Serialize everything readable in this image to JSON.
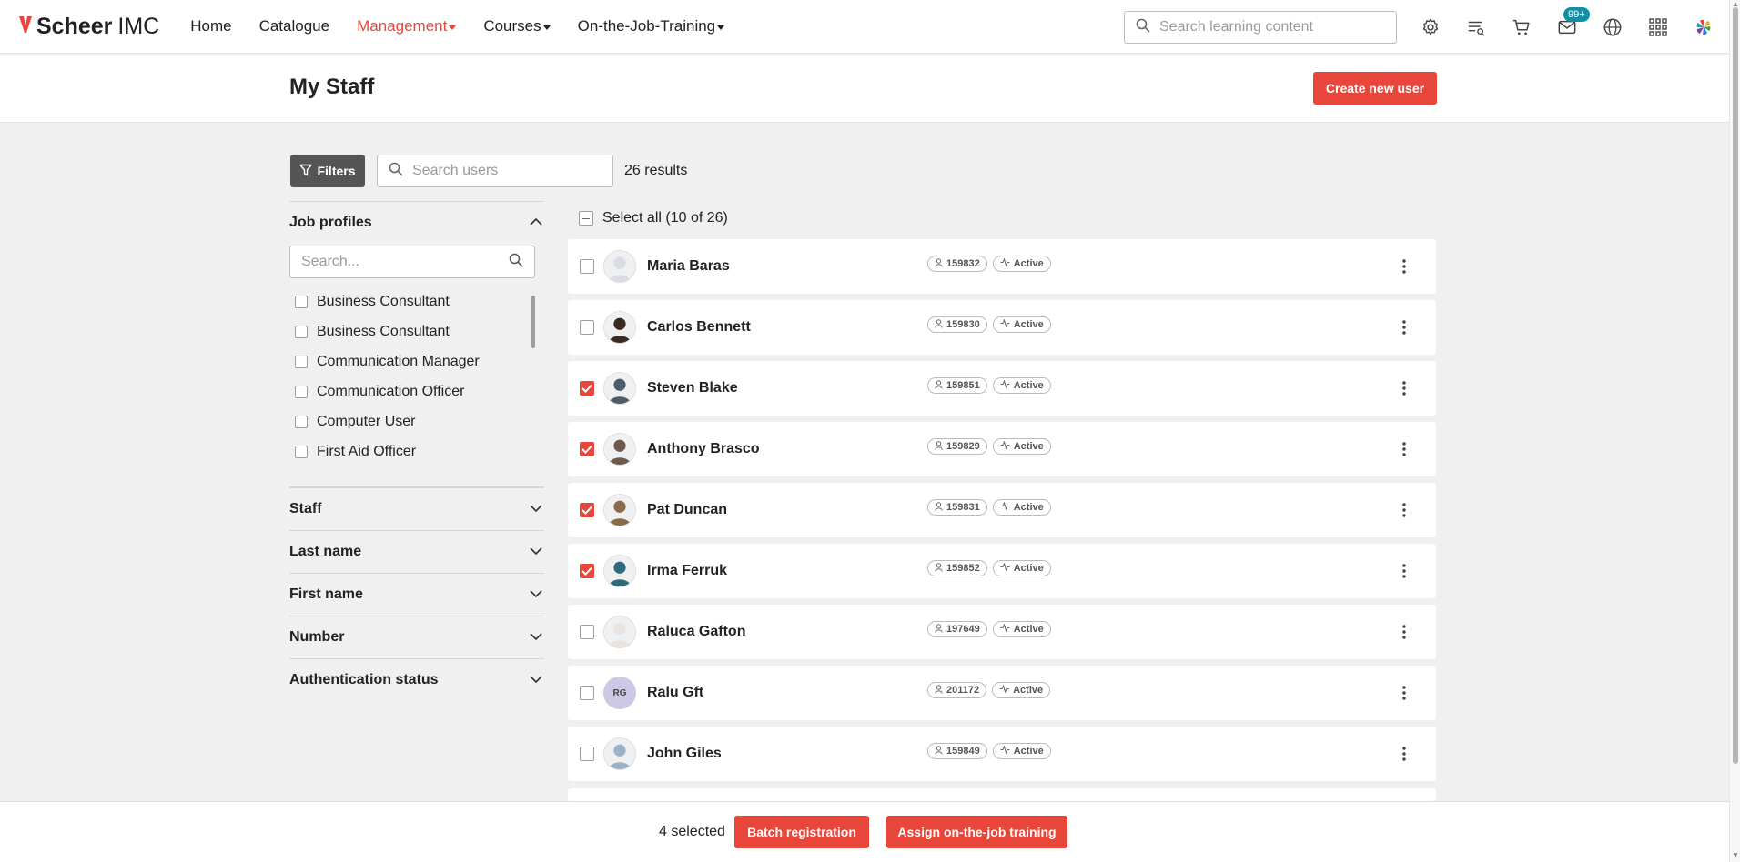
{
  "brand": {
    "name_bold": "Scheer",
    "name_rest": "IMC"
  },
  "nav": {
    "items": [
      "Home",
      "Catalogue",
      "Management",
      "Courses",
      "On-the-Job-Training"
    ],
    "active_item": "Management"
  },
  "global_search": {
    "placeholder": "Search learning content"
  },
  "notifications": {
    "badge": "99+"
  },
  "page": {
    "title": "My Staff",
    "create_button": "Create new user"
  },
  "toolbar": {
    "filters_label": "Filters",
    "search_placeholder": "Search users",
    "results": "26 results"
  },
  "sidebar": {
    "job_profiles": {
      "title": "Job profiles",
      "search_placeholder": "Search...",
      "items": [
        "Business Consultant",
        "Business Consultant",
        "Communication Manager",
        "Communication Officer",
        "Computer User",
        "First Aid Officer"
      ]
    },
    "facets": [
      "Staff",
      "Last name",
      "First name",
      "Number",
      "Authentication status"
    ]
  },
  "list": {
    "select_all": "Select all (10 of 26)",
    "users": [
      {
        "name": "Maria Baras",
        "id": "159832",
        "status": "Active",
        "selected": false
      },
      {
        "name": "Carlos Bennett",
        "id": "159830",
        "status": "Active",
        "selected": false
      },
      {
        "name": "Steven Blake",
        "id": "159851",
        "status": "Active",
        "selected": true
      },
      {
        "name": "Anthony Brasco",
        "id": "159829",
        "status": "Active",
        "selected": true
      },
      {
        "name": "Pat Duncan",
        "id": "159831",
        "status": "Active",
        "selected": true
      },
      {
        "name": "Irma Ferruk",
        "id": "159852",
        "status": "Active",
        "selected": true
      },
      {
        "name": "Raluca Gafton",
        "id": "197649",
        "status": "Active",
        "selected": false
      },
      {
        "name": "Ralu Gft",
        "id": "201172",
        "status": "Active",
        "selected": false,
        "initials": "RG"
      },
      {
        "name": "John Giles",
        "id": "159849",
        "status": "Active",
        "selected": false
      }
    ]
  },
  "bottom_bar": {
    "selected_text": "4 selected",
    "batch_label": "Batch registration",
    "assign_label": "Assign on-the-job training"
  },
  "colors": {
    "accent": "#e8463a",
    "badge": "#0f8fa8",
    "filters_bg": "#555555"
  }
}
